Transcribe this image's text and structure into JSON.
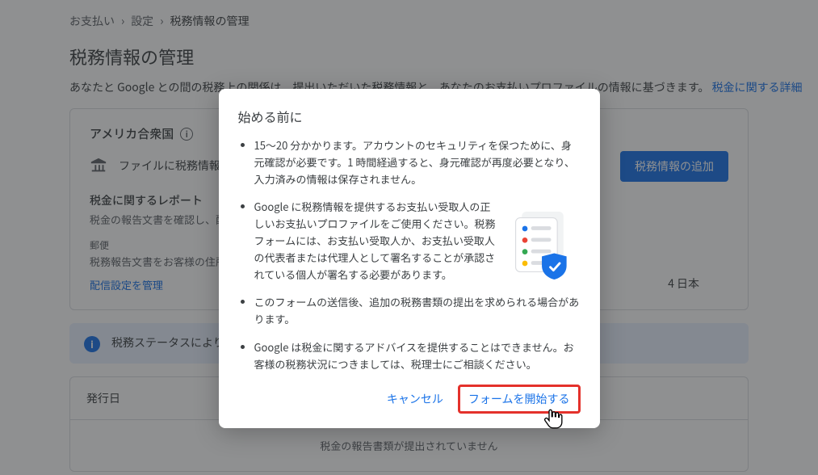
{
  "breadcrumb": {
    "item1": "お支払い",
    "item2": "設定",
    "item3": "税務情報の管理"
  },
  "page": {
    "title": "税務情報の管理",
    "desc": "あなたと Google との間の税務上の関係は、提出いただいた税務情報と、あなたのお支払いプロファイルの情報に基づきます。",
    "desc_link": "税金に関する詳細"
  },
  "card": {
    "country": "アメリカ合衆国",
    "file_status": "ファイルに税務情報なし",
    "add_btn": "税務情報の追加",
    "report_title": "税金に関するレポート",
    "report_desc": "税金の報告文書を確認し、配布に",
    "mail_label": "郵便",
    "mail_desc": "税務報告文書をお客様の住所に送スできます。",
    "delivery_link": "配信設定を管理",
    "address_suffix": "4 日本"
  },
  "banner": {
    "text": "税務ステータスにより、場合は、準備が整い次第 性があります。資格がある"
  },
  "issue": {
    "label": "発行日",
    "empty": "税金の報告書類が提出されていません"
  },
  "dialog": {
    "title": "始める前に",
    "items": [
      "15～20 分かかります。アカウントのセキュリティを保つために、身元確認が必要です。1 時間経過すると、身元確認が再度必要となり、入力済みの情報は保存されません。",
      "Google に税務情報を提供するお支払い受取人の正しいお支払いプロファイルをご使用ください。税務フォームには、お支払い受取人か、お支払い受取人の代表者または代理人として署名することが承認されている個人が署名する必要があります。",
      "このフォームの送信後、追加の税務書類の提出を求められる場合があります。",
      "Google は税金に関するアドバイスを提供することはできません。お客様の税務状況につきましては、税理士にご相談ください。"
    ],
    "cancel": "キャンセル",
    "start": "フォームを開始する"
  }
}
